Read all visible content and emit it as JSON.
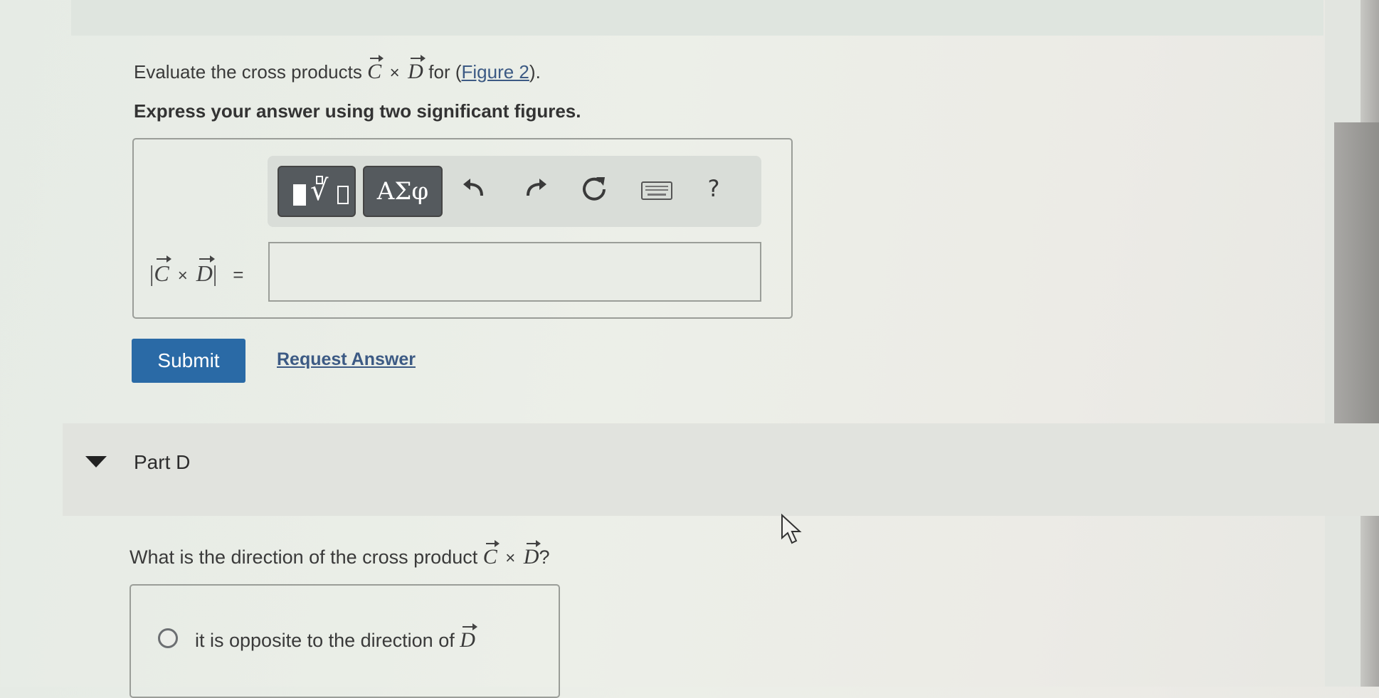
{
  "question": {
    "intro_prefix": "Evaluate the cross products",
    "vector_c": "C",
    "cross_symbol": "×",
    "vector_d": "D",
    "intro_for": "for (",
    "figure_link": "Figure 2",
    "intro_suffix": ").",
    "instruction": "Express your answer using two significant figures."
  },
  "toolbar": {
    "greek_label": "ΑΣφ",
    "help_label": "?"
  },
  "answer": {
    "label_open": "|",
    "label_close": "|",
    "equals": "=",
    "value": ""
  },
  "actions": {
    "submit_label": "Submit",
    "request_label": "Request Answer"
  },
  "part_d": {
    "title": "Part D",
    "question_prefix": "What is the direction of the cross product",
    "question_suffix": "?",
    "choice_1_prefix": "it is opposite to the direction of"
  },
  "colors": {
    "primary_button": "#2a6aa6",
    "link": "#3c5a84",
    "toolbar_button": "#555a5e"
  }
}
